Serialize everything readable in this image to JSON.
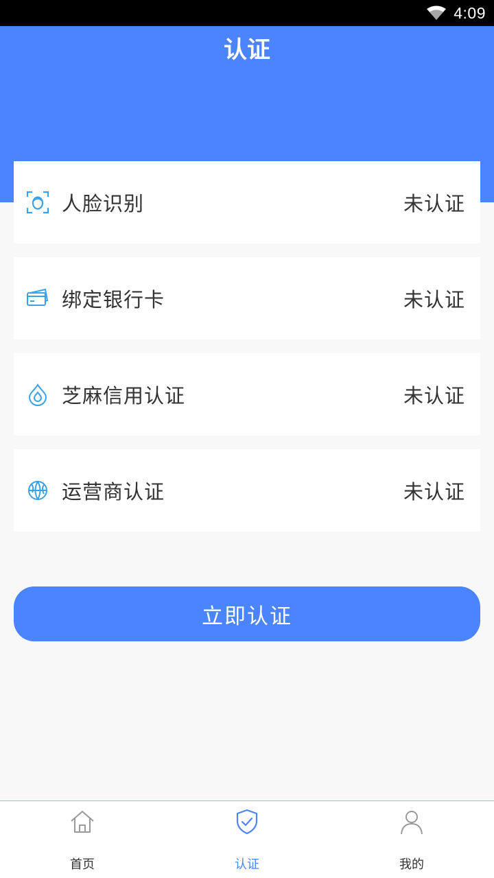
{
  "status_bar": {
    "time": "4:09",
    "wifi_icon": "wifi-icon"
  },
  "header": {
    "title": "认证"
  },
  "colors": {
    "primary": "#4b84ff",
    "icon_blue": "#3aa0e8",
    "text": "#333333",
    "background": "#f8f8f8"
  },
  "cards": [
    {
      "label": "人脸识别",
      "status": "未认证",
      "icon": "face-scan-icon"
    },
    {
      "label": "绑定银行卡",
      "status": "未认证",
      "icon": "bank-card-icon"
    },
    {
      "label": "芝麻信用认证",
      "status": "未认证",
      "icon": "drop-icon"
    },
    {
      "label": "运营商认证",
      "status": "未认证",
      "icon": "globe-icon"
    }
  ],
  "button": {
    "label": "立即认证"
  },
  "bottom_nav": [
    {
      "label": "首页",
      "icon": "home-icon",
      "active": false
    },
    {
      "label": "认证",
      "icon": "shield-check-icon",
      "active": true
    },
    {
      "label": "我的",
      "icon": "user-icon",
      "active": false
    }
  ]
}
